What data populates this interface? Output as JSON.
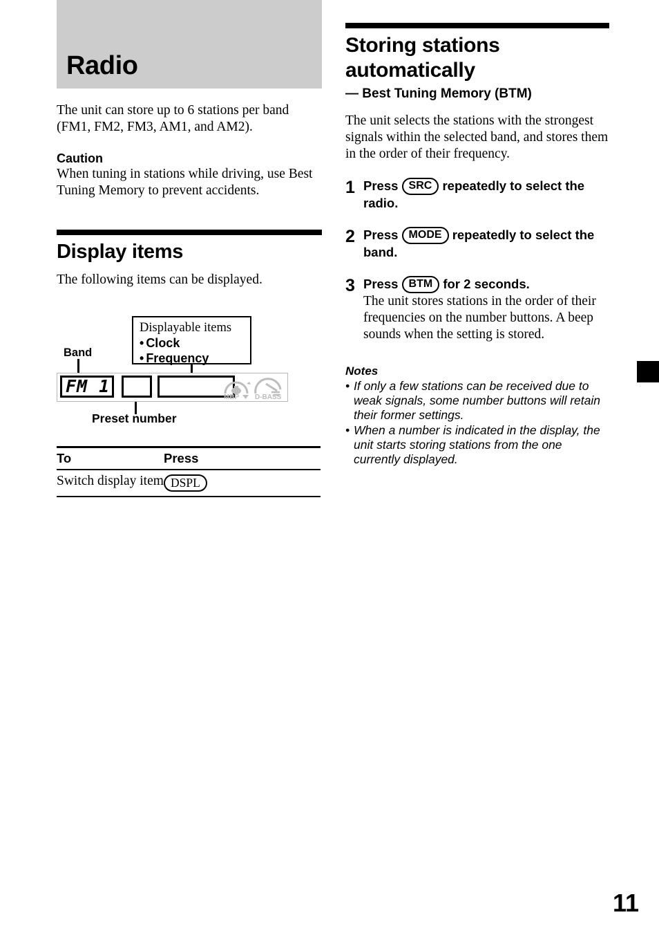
{
  "page": {
    "number": "11"
  },
  "left": {
    "chapter_title": "Radio",
    "intro": "The unit can store up to 6 stations per band (FM1, FM2, FM3, AM1, and AM2).",
    "caution_heading": "Caution",
    "caution_body": "When tuning in stations while driving, use Best Tuning Memory to prevent accidents.",
    "section": {
      "title": "Display items",
      "subtitle": "The following items can be displayed."
    },
    "diagram": {
      "band_label": "Band",
      "preset_label": "Preset number",
      "callout_heading": "Displayable items",
      "callout_items": [
        "Clock",
        "Frequency"
      ],
      "bullet": "•",
      "lcd_band_value": "FM 1",
      "lcd_icon_mbp": "MBP",
      "lcd_icon_dbass": "D-BASS"
    },
    "table": {
      "headers": [
        "To",
        "Press"
      ],
      "rows": [
        {
          "to": "Switch display item",
          "press_key": "DSPL"
        }
      ]
    }
  },
  "right": {
    "title": "Storing stations automatically",
    "subtitle": "— Best Tuning Memory (BTM)",
    "intro": "The unit selects the stations with the strongest signals within the selected band, and stores them in the order of their frequency.",
    "steps": [
      {
        "num": "1",
        "before": "Press",
        "key": "SRC",
        "after": "repeatedly to select the radio.",
        "detail": ""
      },
      {
        "num": "2",
        "before": "Press",
        "key": "MODE",
        "after": "repeatedly to select the band.",
        "detail": ""
      },
      {
        "num": "3",
        "before": "Press",
        "key": "BTM",
        "after": "for 2 seconds.",
        "detail": "The unit stores stations in the order of their frequencies on the number buttons. A beep sounds when the setting is stored."
      }
    ],
    "notes_heading": "Notes",
    "notes_bullet": "•",
    "notes": [
      "If only a few stations can be received due to weak signals, some number buttons will retain their former settings.",
      "When a number is indicated in the display, the unit starts storing stations from the one currently displayed."
    ]
  },
  "colors": {
    "chapter_band_gray": "#cccccc",
    "rule_black": "#000000",
    "lcd_icon_gray": "#bdbdbd"
  }
}
